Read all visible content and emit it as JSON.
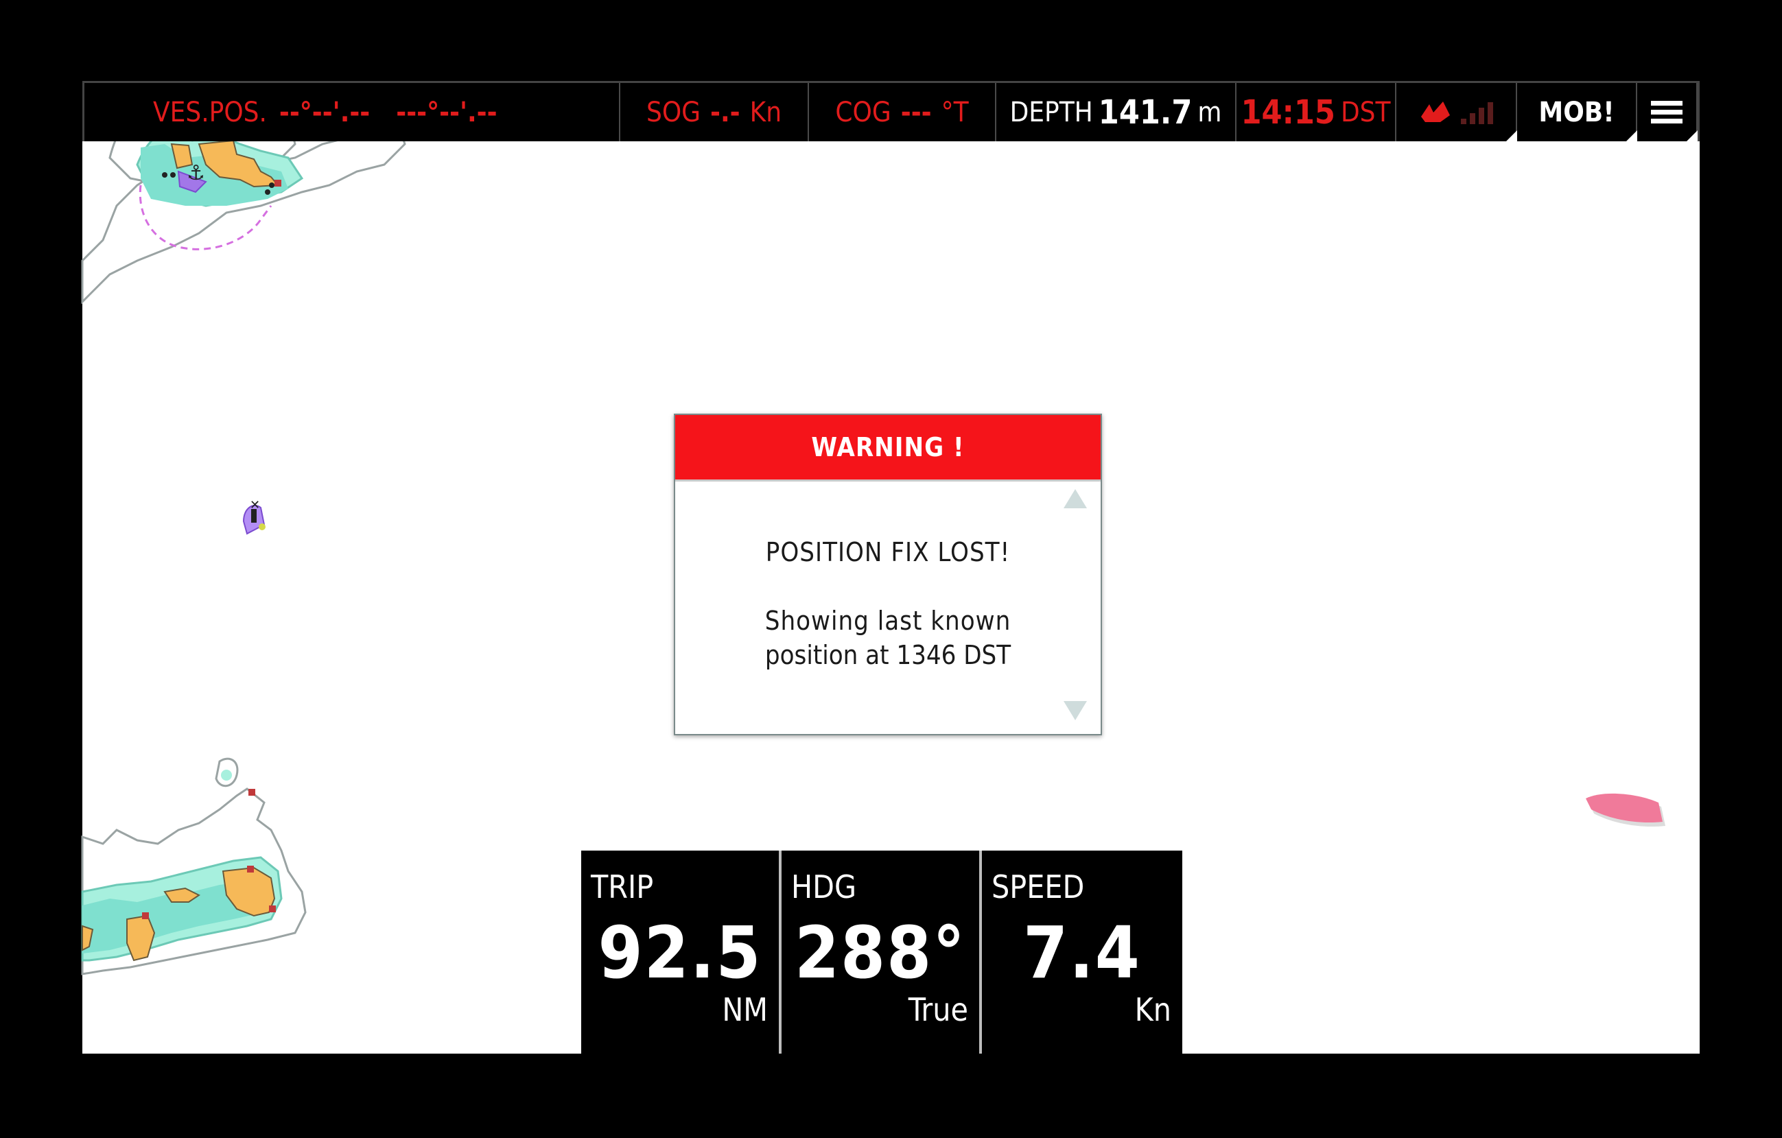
{
  "topbar": {
    "vessel_position": {
      "label": "VES.POS.",
      "latitude": "--°--'.--",
      "longitude": "---°--'.--"
    },
    "sog": {
      "label": "SOG",
      "value": "-.-",
      "unit": "Kn"
    },
    "cog": {
      "label": "COG",
      "value": "---",
      "unit": "°T"
    },
    "depth": {
      "label": "DEPTH",
      "value": "141.7",
      "unit": "m"
    },
    "time": {
      "value": "14:15",
      "zone": "DST"
    },
    "mob_label": "MOB!",
    "icons": {
      "status": "sailboat-alert-icon",
      "signal": "signal-strength-icon",
      "menu": "hamburger-menu-icon"
    },
    "signal_level_bars": 0
  },
  "dialog": {
    "title": "WARNING !",
    "line1": "POSITION FIX LOST!",
    "line2a": "Showing last known",
    "line2b": "position at 1346 DST"
  },
  "tiles": [
    {
      "label": "TRIP",
      "value": "92.5",
      "unit": "NM"
    },
    {
      "label": "HDG",
      "value": "288°",
      "unit": "True"
    },
    {
      "label": "SPEED",
      "value": "7.4",
      "unit": "Kn"
    }
  ],
  "colors": {
    "alert": "#e21c1c",
    "warning_header": "#f5141a",
    "shallow": "#7fe0cf",
    "land": "#f6b958",
    "vessel": "#f07a9a"
  }
}
